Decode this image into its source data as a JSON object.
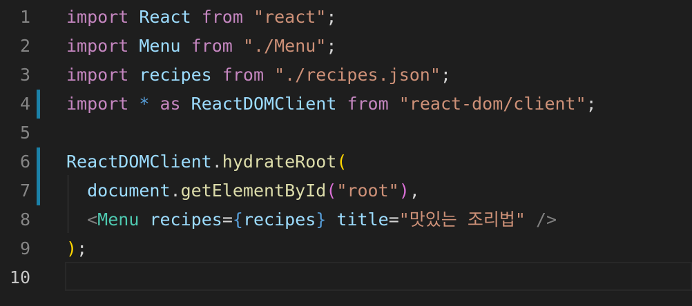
{
  "editor": {
    "line_numbers": [
      "1",
      "2",
      "3",
      "4",
      "5",
      "6",
      "7",
      "8",
      "9",
      "10"
    ],
    "active_line": 10,
    "lines": [
      {
        "tokens": [
          {
            "t": "import",
            "c": "kw"
          },
          {
            "t": " ",
            "c": "pun"
          },
          {
            "t": "React",
            "c": "id"
          },
          {
            "t": " ",
            "c": "pun"
          },
          {
            "t": "from",
            "c": "kw"
          },
          {
            "t": " ",
            "c": "pun"
          },
          {
            "t": "\"react\"",
            "c": "str"
          },
          {
            "t": ";",
            "c": "pun"
          }
        ]
      },
      {
        "tokens": [
          {
            "t": "import",
            "c": "kw"
          },
          {
            "t": " ",
            "c": "pun"
          },
          {
            "t": "Menu",
            "c": "id"
          },
          {
            "t": " ",
            "c": "pun"
          },
          {
            "t": "from",
            "c": "kw"
          },
          {
            "t": " ",
            "c": "pun"
          },
          {
            "t": "\"./Menu\"",
            "c": "str"
          },
          {
            "t": ";",
            "c": "pun"
          }
        ]
      },
      {
        "tokens": [
          {
            "t": "import",
            "c": "kw"
          },
          {
            "t": " ",
            "c": "pun"
          },
          {
            "t": "recipes",
            "c": "id"
          },
          {
            "t": " ",
            "c": "pun"
          },
          {
            "t": "from",
            "c": "kw"
          },
          {
            "t": " ",
            "c": "pun"
          },
          {
            "t": "\"./recipes.json\"",
            "c": "str"
          },
          {
            "t": ";",
            "c": "pun"
          }
        ]
      },
      {
        "tokens": [
          {
            "t": "import",
            "c": "kw"
          },
          {
            "t": " ",
            "c": "pun"
          },
          {
            "t": "*",
            "c": "op"
          },
          {
            "t": " ",
            "c": "pun"
          },
          {
            "t": "as",
            "c": "kw"
          },
          {
            "t": " ",
            "c": "pun"
          },
          {
            "t": "ReactDOMClient",
            "c": "id"
          },
          {
            "t": " ",
            "c": "pun"
          },
          {
            "t": "from",
            "c": "kw"
          },
          {
            "t": " ",
            "c": "pun"
          },
          {
            "t": "\"react-dom/client\"",
            "c": "str"
          },
          {
            "t": ";",
            "c": "pun"
          }
        ]
      },
      {
        "tokens": []
      },
      {
        "tokens": [
          {
            "t": "ReactDOMClient",
            "c": "id"
          },
          {
            "t": ".",
            "c": "pun"
          },
          {
            "t": "hydrateRoot",
            "c": "fn"
          },
          {
            "t": "(",
            "c": "paren-y"
          }
        ]
      },
      {
        "tokens": [
          {
            "t": "  ",
            "c": "pun"
          },
          {
            "t": "document",
            "c": "id"
          },
          {
            "t": ".",
            "c": "pun"
          },
          {
            "t": "getElementById",
            "c": "fn"
          },
          {
            "t": "(",
            "c": "paren"
          },
          {
            "t": "\"root\"",
            "c": "str"
          },
          {
            "t": ")",
            "c": "paren"
          },
          {
            "t": ",",
            "c": "pun"
          }
        ]
      },
      {
        "tokens": [
          {
            "t": "  ",
            "c": "pun"
          },
          {
            "t": "<",
            "c": "tag"
          },
          {
            "t": "Menu",
            "c": "cls"
          },
          {
            "t": " ",
            "c": "pun"
          },
          {
            "t": "recipes",
            "c": "id"
          },
          {
            "t": "=",
            "c": "pun"
          },
          {
            "t": "{",
            "c": "brace"
          },
          {
            "t": "recipes",
            "c": "id"
          },
          {
            "t": "}",
            "c": "brace"
          },
          {
            "t": " ",
            "c": "pun"
          },
          {
            "t": "title",
            "c": "id"
          },
          {
            "t": "=",
            "c": "pun"
          },
          {
            "t": "\"맛있는 조리법\"",
            "c": "str"
          },
          {
            "t": " ",
            "c": "pun"
          },
          {
            "t": "/>",
            "c": "tag"
          }
        ]
      },
      {
        "tokens": [
          {
            "t": ")",
            "c": "paren-y"
          },
          {
            "t": ";",
            "c": "pun"
          }
        ]
      },
      {
        "tokens": []
      }
    ],
    "modified_lines": [
      4,
      6,
      7
    ],
    "colors": {
      "background": "#1e1e1e",
      "keyword": "#c586c0",
      "identifier": "#9cdcfe",
      "string": "#ce9178",
      "function": "#dcdcaa",
      "component": "#4ec9b0",
      "diff_marker": "#1b81a8"
    }
  }
}
